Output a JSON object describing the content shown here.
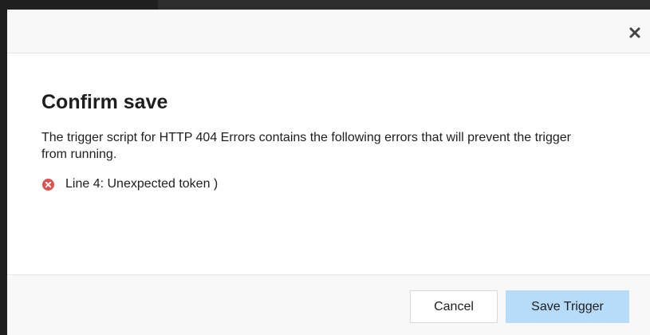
{
  "dialog": {
    "title": "Confirm save",
    "message": "The trigger script for HTTP 404 Errors contains the following errors that will prevent the trigger from running.",
    "errors": [
      {
        "text": "Line 4: Unexpected token )"
      }
    ],
    "close_icon": "close-icon",
    "error_icon": "error-circle-icon",
    "error_icon_color": "#d9534f"
  },
  "footer": {
    "cancel_label": "Cancel",
    "save_label": "Save Trigger",
    "save_button_color": "#b6dcf9"
  }
}
